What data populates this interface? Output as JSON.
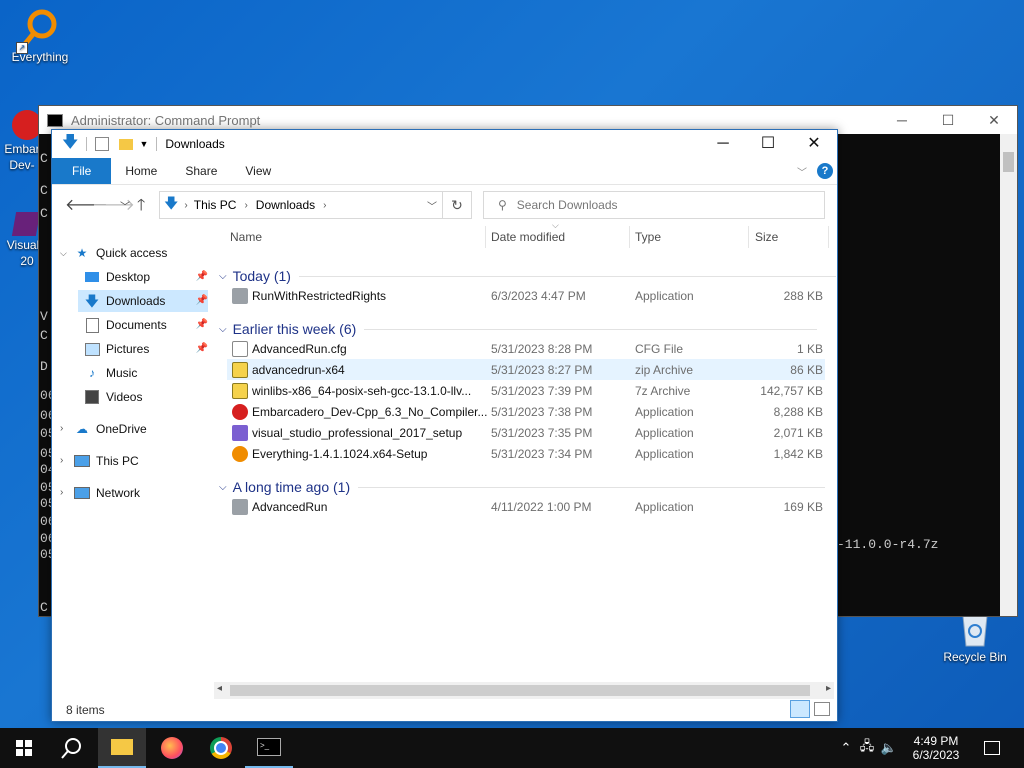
{
  "desktop": {
    "icons": [
      {
        "label": "Everything"
      },
      {
        "label": "Embar"
      },
      {
        "label": "Dev-"
      },
      {
        "label": "Visual"
      },
      {
        "label": "20"
      },
      {
        "label": "Recycle Bin"
      }
    ]
  },
  "cmd": {
    "title": "Administrator: Command Prompt",
    "visible_text": "-11.0.0-r4.7z",
    "left_glyphs": [
      "C",
      "C",
      "C",
      "V",
      "C",
      "D",
      "06",
      "06",
      "05",
      "05",
      "04",
      "05",
      "05",
      "06",
      "06",
      "05",
      "C"
    ]
  },
  "explorer": {
    "title": "Downloads",
    "ribbon_tabs": [
      "File",
      "Home",
      "Share",
      "View"
    ],
    "address": {
      "segments": [
        "This PC",
        "Downloads"
      ]
    },
    "search_placeholder": "Search Downloads",
    "nav": {
      "quick_access": "Quick access",
      "items": [
        {
          "label": "Desktop",
          "pinned": true
        },
        {
          "label": "Downloads",
          "pinned": true,
          "selected": true
        },
        {
          "label": "Documents",
          "pinned": true
        },
        {
          "label": "Pictures",
          "pinned": true
        },
        {
          "label": "Music"
        },
        {
          "label": "Videos"
        }
      ],
      "onedrive": "OneDrive",
      "thispc": "This PC",
      "network": "Network"
    },
    "columns": {
      "name": "Name",
      "date": "Date modified",
      "type": "Type",
      "size": "Size"
    },
    "groups": [
      {
        "label": "Today (1)",
        "files": [
          {
            "name": "RunWithRestrictedRights",
            "date": "6/3/2023 4:47 PM",
            "type": "Application",
            "size": "288 KB",
            "icon": "app-gray"
          }
        ]
      },
      {
        "label": "Earlier this week (6)",
        "files": [
          {
            "name": "AdvancedRun.cfg",
            "date": "5/31/2023 8:28 PM",
            "type": "CFG File",
            "size": "1 KB",
            "icon": "doc"
          },
          {
            "name": "advancedrun-x64",
            "date": "5/31/2023 8:27 PM",
            "type": "zip Archive",
            "size": "86 KB",
            "icon": "zip"
          },
          {
            "name": "winlibs-x86_64-posix-seh-gcc-13.1.0-llv...",
            "date": "5/31/2023 7:39 PM",
            "type": "7z Archive",
            "size": "142,757 KB",
            "icon": "zip"
          },
          {
            "name": "Embarcadero_Dev-Cpp_6.3_No_Compiler...",
            "date": "5/31/2023 7:38 PM",
            "type": "Application",
            "size": "8,288 KB",
            "icon": "app-red"
          },
          {
            "name": "visual_studio_professional_2017_setup",
            "date": "5/31/2023 7:35 PM",
            "type": "Application",
            "size": "2,071 KB",
            "icon": "app-vs"
          },
          {
            "name": "Everything-1.4.1.1024.x64-Setup",
            "date": "5/31/2023 7:34 PM",
            "type": "Application",
            "size": "1,842 KB",
            "icon": "app-orange"
          }
        ]
      },
      {
        "label": "A long time ago (1)",
        "files": [
          {
            "name": "AdvancedRun",
            "date": "4/11/2022 1:00 PM",
            "type": "Application",
            "size": "169 KB",
            "icon": "app-gray"
          }
        ]
      }
    ],
    "status": "8 items"
  },
  "taskbar": {
    "time": "4:49 PM",
    "date": "6/3/2023"
  },
  "colors": {
    "accent": "#1979ca",
    "group_text": "#1e3287",
    "desktop": "#0a64c8"
  }
}
